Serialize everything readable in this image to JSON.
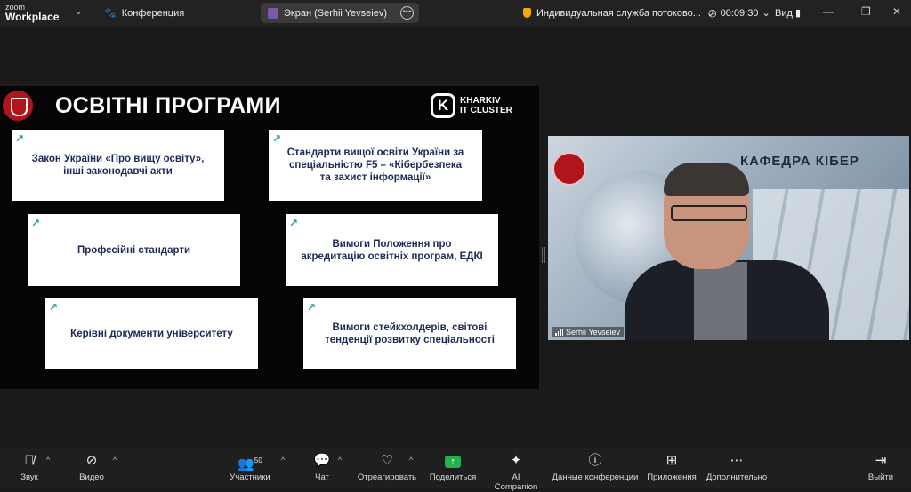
{
  "titlebar": {
    "zoom": "zoom",
    "workplace": "Workplace",
    "conference": "Конференция",
    "screen_share": "Экран (Serhii Yevseiev)",
    "stream": "Индивидуальная служба потоково...",
    "timer": "00:09:30",
    "view": "Вид"
  },
  "slide": {
    "title": "ОСВІТНІ ПРОГРАМИ",
    "brand_line1": "KHARKIV",
    "brand_line2": "IT CLUSTER",
    "brand_letter": "K",
    "boxes": [
      "Закон України «Про вищу освіту», інші законодавчі акти",
      "Стандарти вищої освіти України за спеціальністю F5 – «Кібербезпека та захист інформації»",
      "Професійні стандарти",
      "Вимоги Положення про акредитацію освітніх програм, ЕДКІ",
      "Керівні документи університету",
      "Вимоги стейкхолдерів, світові тенденції розвитку спеціальності"
    ]
  },
  "video": {
    "participant": "Serhii Yevseiev",
    "background_text": "КАФЕДРА КІБЕР"
  },
  "toolbar": {
    "audio": "Звук",
    "video": "Видео",
    "participants": "Участники",
    "participants_count": "50",
    "chat": "Чат",
    "react": "Отреагировать",
    "share": "Поделиться",
    "ai": "AI Companion",
    "meeting_info": "Данные конференции",
    "apps": "Приложения",
    "more": "Дополнительно",
    "leave": "Выйти"
  }
}
